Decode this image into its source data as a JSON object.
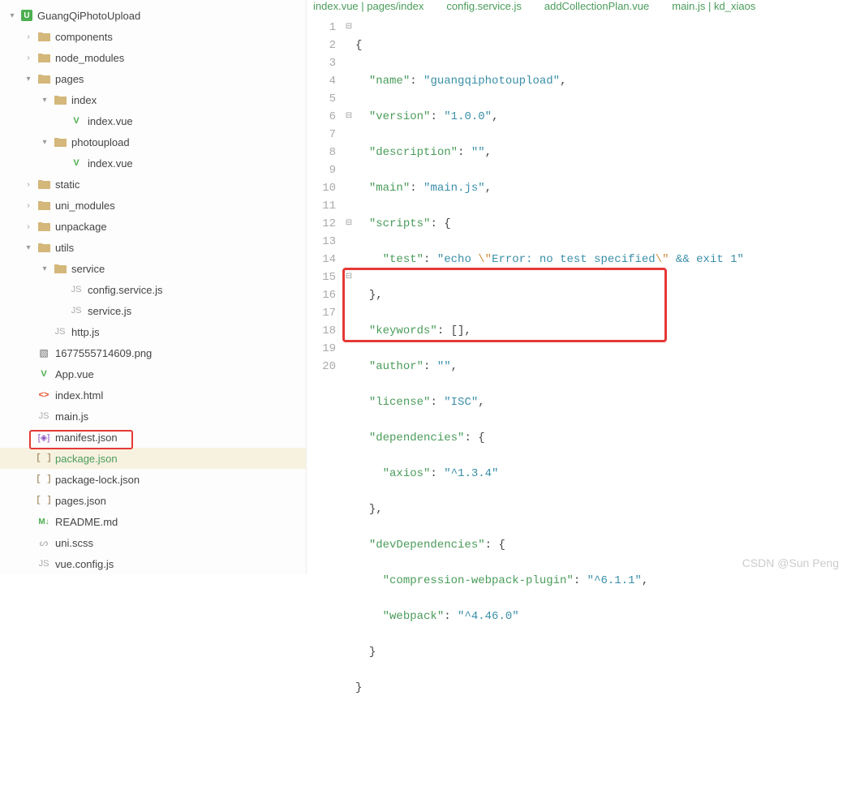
{
  "project_name": "GuangQiPhotoUpload",
  "tree": [
    {
      "indent": 0,
      "chev": "▾",
      "iconType": "project",
      "iconText": "U",
      "label": "GuangQiPhotoUpload",
      "name": "project-root"
    },
    {
      "indent": 1,
      "chev": "›",
      "iconType": "folder",
      "label": "components",
      "name": "folder-components"
    },
    {
      "indent": 1,
      "chev": "›",
      "iconType": "folder",
      "label": "node_modules",
      "name": "folder-node-modules"
    },
    {
      "indent": 1,
      "chev": "▾",
      "iconType": "folder",
      "label": "pages",
      "name": "folder-pages"
    },
    {
      "indent": 2,
      "chev": "▾",
      "iconType": "folder",
      "label": "index",
      "name": "folder-index"
    },
    {
      "indent": 3,
      "chev": "",
      "iconType": "vue",
      "iconText": "V",
      "label": "index.vue",
      "name": "file-index-vue-1"
    },
    {
      "indent": 2,
      "chev": "▾",
      "iconType": "folder",
      "label": "photoupload",
      "name": "folder-photoupload"
    },
    {
      "indent": 3,
      "chev": "",
      "iconType": "vue",
      "iconText": "V",
      "label": "index.vue",
      "name": "file-index-vue-2"
    },
    {
      "indent": 1,
      "chev": "›",
      "iconType": "folder",
      "label": "static",
      "name": "folder-static"
    },
    {
      "indent": 1,
      "chev": "›",
      "iconType": "folder",
      "label": "uni_modules",
      "name": "folder-uni-modules"
    },
    {
      "indent": 1,
      "chev": "›",
      "iconType": "folder",
      "label": "unpackage",
      "name": "folder-unpackage"
    },
    {
      "indent": 1,
      "chev": "▾",
      "iconType": "folder",
      "label": "utils",
      "name": "folder-utils"
    },
    {
      "indent": 2,
      "chev": "▾",
      "iconType": "folder",
      "label": "service",
      "name": "folder-service"
    },
    {
      "indent": 3,
      "chev": "",
      "iconType": "js",
      "iconText": "JS",
      "label": "config.service.js",
      "name": "file-config-service-js"
    },
    {
      "indent": 3,
      "chev": "",
      "iconType": "js",
      "iconText": "JS",
      "label": "service.js",
      "name": "file-service-js"
    },
    {
      "indent": 2,
      "chev": "",
      "iconType": "js",
      "iconText": "JS",
      "label": "http.js",
      "name": "file-http-js"
    },
    {
      "indent": 1,
      "chev": "",
      "iconType": "img",
      "iconText": "▧",
      "label": "1677555714609.png",
      "name": "file-png"
    },
    {
      "indent": 1,
      "chev": "",
      "iconType": "vue",
      "iconText": "V",
      "label": "App.vue",
      "name": "file-app-vue"
    },
    {
      "indent": 1,
      "chev": "",
      "iconType": "html",
      "iconText": "<>",
      "label": "index.html",
      "name": "file-index-html"
    },
    {
      "indent": 1,
      "chev": "",
      "iconType": "js",
      "iconText": "JS",
      "label": "main.js",
      "name": "file-main-js"
    },
    {
      "indent": 1,
      "chev": "",
      "iconType": "manifest",
      "iconText": "[◈]",
      "label": "manifest.json",
      "name": "file-manifest-json"
    },
    {
      "indent": 1,
      "chev": "",
      "iconType": "json",
      "iconText": "[ ]",
      "label": "package.json",
      "name": "file-package-json",
      "selected": true
    },
    {
      "indent": 1,
      "chev": "",
      "iconType": "json",
      "iconText": "[ ]",
      "label": "package-lock.json",
      "name": "file-package-lock-json"
    },
    {
      "indent": 1,
      "chev": "",
      "iconType": "json",
      "iconText": "[ ]",
      "label": "pages.json",
      "name": "file-pages-json"
    },
    {
      "indent": 1,
      "chev": "",
      "iconType": "md",
      "iconText": "M↓",
      "label": "README.md",
      "name": "file-readme-md"
    },
    {
      "indent": 1,
      "chev": "",
      "iconType": "scss",
      "iconText": "ᔕ",
      "label": "uni.scss",
      "name": "file-uni-scss"
    },
    {
      "indent": 1,
      "chev": "",
      "iconType": "js",
      "iconText": "JS",
      "label": "vue.config.js",
      "name": "file-vue-config-js"
    }
  ],
  "tabs": [
    "index.vue | pages/index",
    "config.service.js",
    "addCollectionPlan.vue",
    "main.js | kd_xiaos"
  ],
  "fold_markers": [
    "⊟",
    "",
    "",
    "",
    "",
    "⊟",
    "",
    "",
    "",
    "",
    "",
    "⊟",
    "",
    "",
    "⊟",
    "",
    "",
    "",
    "",
    ""
  ],
  "code": {
    "name_key": "\"name\"",
    "name_val": "\"guangqiphotoupload\"",
    "version_key": "\"version\"",
    "version_val": "\"1.0.0\"",
    "description_key": "\"description\"",
    "description_val": "\"\"",
    "main_key": "\"main\"",
    "main_val": "\"main.js\"",
    "scripts_key": "\"scripts\"",
    "test_key": "\"test\"",
    "test_val1": "\"echo ",
    "test_esc1": "\\\"",
    "test_val2": "Error: no test specified",
    "test_esc2": "\\\"",
    "test_val3": " && exit 1\"",
    "keywords_key": "\"keywords\"",
    "author_key": "\"author\"",
    "author_val": "\"\"",
    "license_key": "\"license\"",
    "license_val": "\"ISC\"",
    "dependencies_key": "\"dependencies\"",
    "axios_key": "\"axios\"",
    "axios_val": "\"^1.3.4\"",
    "devdeps_key": "\"devDependencies\"",
    "cwp_key": "\"compression-webpack-plugin\"",
    "cwp_val": "\"^6.1.1\"",
    "webpack_key": "\"webpack\"",
    "webpack_val": "\"^4.46.0\""
  },
  "watermark": "CSDN @Sun  Peng"
}
